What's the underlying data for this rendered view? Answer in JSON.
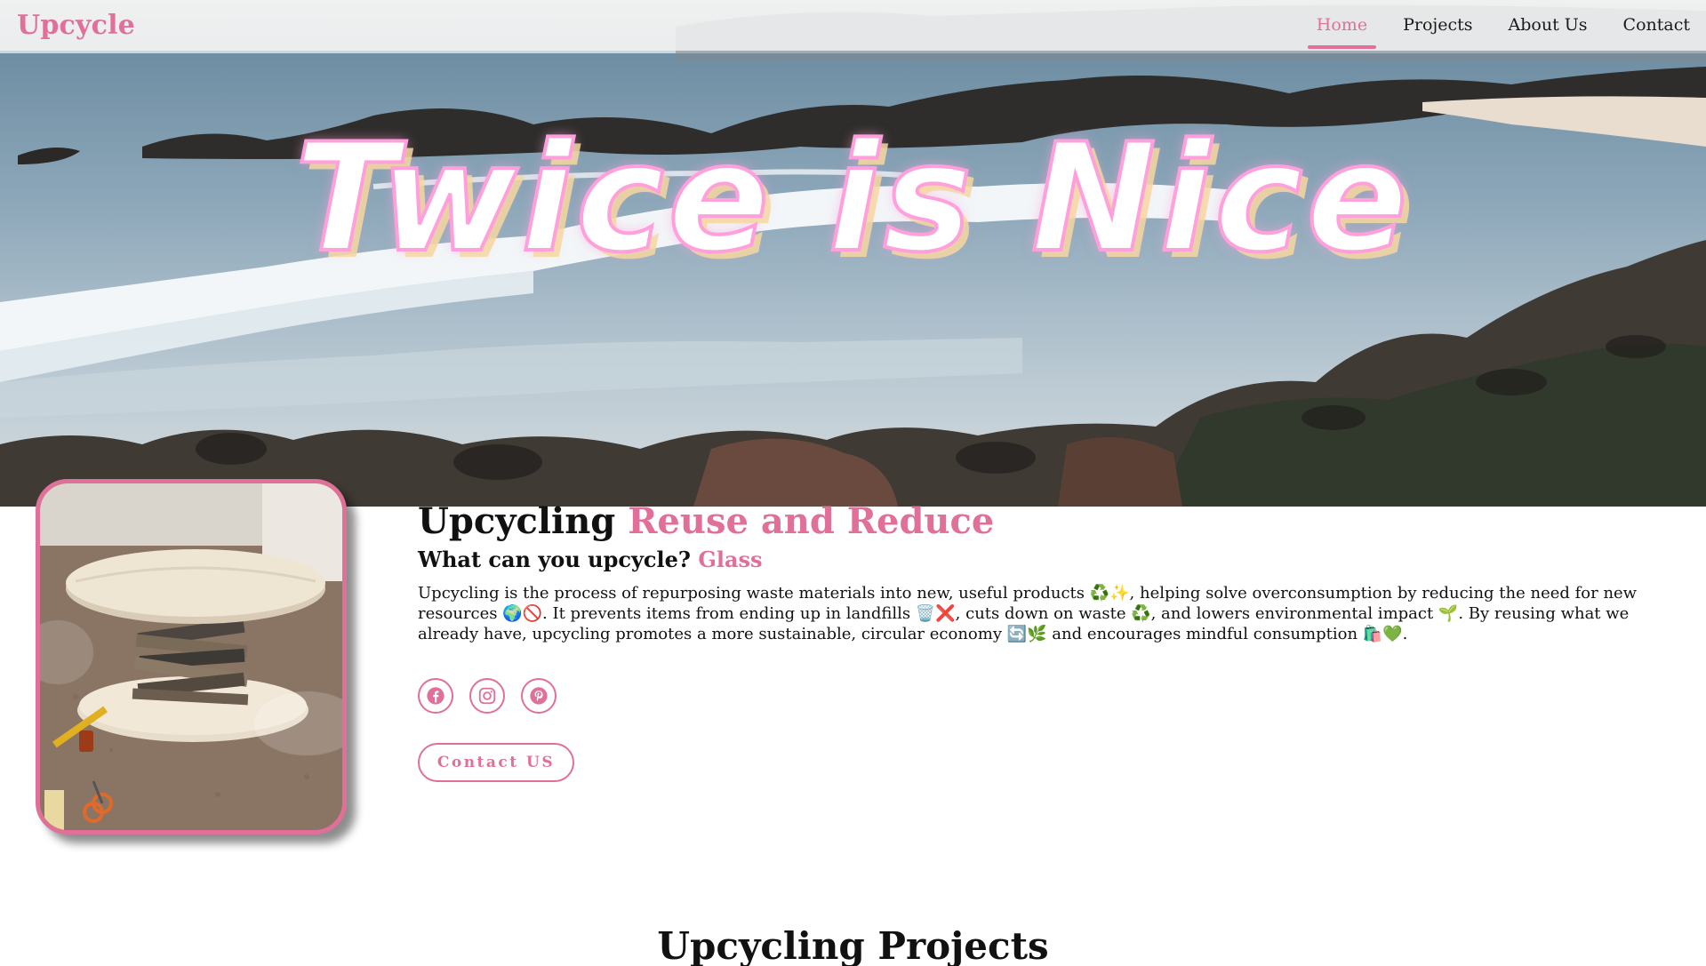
{
  "brand": {
    "name": "Upcycle"
  },
  "nav": {
    "items": [
      {
        "label": "Home",
        "active": true
      },
      {
        "label": "Projects",
        "active": false
      },
      {
        "label": "About Us",
        "active": false
      },
      {
        "label": "Contact",
        "active": false
      }
    ]
  },
  "hero": {
    "title": "Twice is Nice",
    "background_image": "rocky-beach-waves"
  },
  "about": {
    "headline_prefix": "Upcycling",
    "headline_accent": "Reuse and Reduce",
    "subhead_prefix": "What can you upcycle?",
    "subhead_accent": "Glass",
    "description": "Upcycling is the process of repurposing waste materials into new, useful products ♻️✨, helping solve overconsumption by reducing the need for new resources 🌍🚫. It prevents items from ending up in landfills 🗑️❌, cuts down on waste ♻️, and lowers environmental impact 🌱. By reusing what we already have, upcycling promotes a more sustainable, circular economy 🔄🌿 and encourages mindful consumption 🛍️💚.",
    "profile_image": "upcycled-book-stack-table",
    "socials": [
      {
        "icon": "facebook-icon"
      },
      {
        "icon": "instagram-icon"
      },
      {
        "icon": "pinterest-icon"
      }
    ],
    "contact_button_label": "Contact US"
  },
  "projects": {
    "heading": "Upcycling Projects"
  },
  "colors": {
    "accent": "#e0709a",
    "text": "#111111",
    "navbar_bg": "#f0f0f0"
  }
}
